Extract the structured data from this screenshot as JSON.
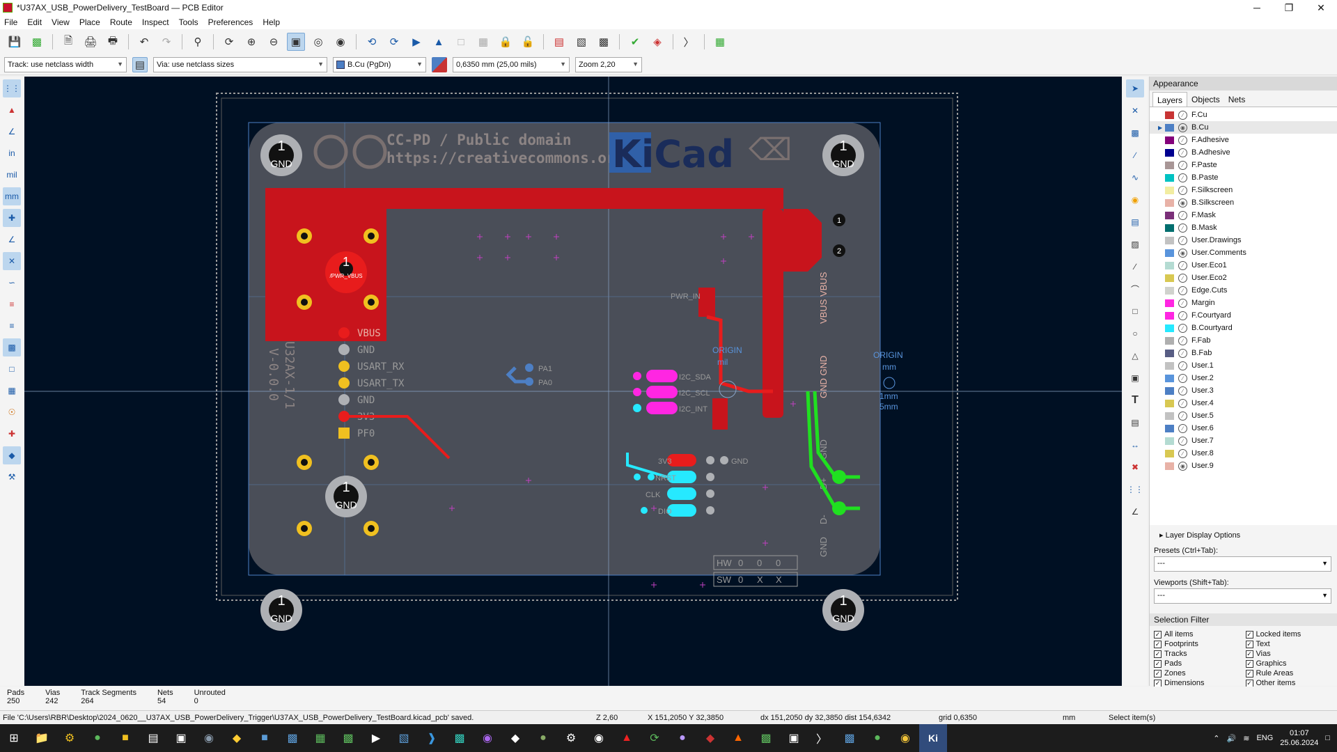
{
  "window": {
    "title": "*U37AX_USB_PowerDelivery_TestBoard — PCB Editor",
    "controls": [
      "─",
      "❐",
      "✕"
    ]
  },
  "menu": [
    "File",
    "Edit",
    "View",
    "Place",
    "Route",
    "Inspect",
    "Tools",
    "Preferences",
    "Help"
  ],
  "toolbar": {
    "icons": [
      "save-icon",
      "board-setup-icon",
      "page-settings-icon",
      "print-icon",
      "plot-icon",
      "undo-icon",
      "redo-icon",
      "find-icon",
      "refresh-icon",
      "zoom-in-icon",
      "zoom-out-icon",
      "zoom-fit-icon",
      "zoom-objects-icon",
      "zoom-area-icon",
      "rotate-ccw-icon",
      "rotate-cw-icon",
      "flip-icon",
      "mirror-icon",
      "group-icon",
      "ungroup-icon",
      "lock-icon",
      "unlock-icon",
      "netlist-icon",
      "footprint-editor-icon",
      "footprint-browser-icon",
      "drc-icon",
      "zones-icon",
      "python-icon",
      "plugin-icon"
    ]
  },
  "options": {
    "track": "Track: use netclass width",
    "via": "Via: use netclass sizes",
    "layer": "B.Cu (PgDn)",
    "layer_color": "#4d7fc4",
    "grid": "0,6350 mm (25,00 mils)",
    "zoom": "Zoom 2,20"
  },
  "left_tools": [
    "grid-icon",
    "drc-marker-icon",
    "ratsnest-icon",
    "inches-unit",
    "mils-unit",
    "mm-unit",
    "cursor-icon",
    "polar-icon",
    "ratsnest-lines-icon",
    "curved-ratsnest-icon",
    "zone-fill-icon",
    "zone-outline-icon",
    "track-display-icon",
    "via-display-icon",
    "pad-display-icon",
    "high-contrast-icon",
    "net-color-icon",
    "board-layers-icon",
    "properties-icon"
  ],
  "left_labels": {
    "in": "in",
    "mil": "mil",
    "mm": "mm"
  },
  "right_tools": [
    "select-icon",
    "local-ratsnest-icon",
    "footprint-icon",
    "route-track-icon",
    "tune-length-icon",
    "via-icon",
    "zone-icon",
    "rule-area-icon",
    "line-icon",
    "arc-icon",
    "rect-icon",
    "circle-icon",
    "polygon-icon",
    "image-icon",
    "text-icon",
    "textbox-icon",
    "dimension-icon",
    "delete-icon",
    "grid-origin-icon",
    "measure-icon"
  ],
  "board": {
    "silk": [
      "CC-PD / Public domain",
      "https://creativecommons.org"
    ],
    "logo": "KiCad",
    "labels": [
      "VBUS",
      "GND",
      "USART_RX",
      "USART_TX",
      "GND",
      "3V3",
      "PF0",
      "PA1",
      "PA0",
      "I2C_SDA",
      "I2C_SCL",
      "I2C_INT",
      "PWR_IN",
      "3V3",
      "GND",
      "NRST",
      "CLK",
      "DIO",
      "ORIGIN",
      "ORIGIN",
      "mil",
      "mm",
      "1mm",
      "5mm",
      "VBUS VBUS",
      "GND GND",
      "GND",
      "D+",
      "D-",
      "GND",
      "HW",
      "SW",
      "/PWR_VBUS",
      "U32AX-1/1",
      "V-0.0.0"
    ],
    "mount_holes": [
      {
        "n": "1",
        "net": "GND"
      },
      {
        "n": "1",
        "net": "GND"
      },
      {
        "n": "1",
        "net": "GND"
      },
      {
        "n": "1",
        "net": "GND"
      },
      {
        "n": "1",
        "net": "GND"
      }
    ],
    "pwr_pad": {
      "n": "1",
      "net": "/PWR_VBUS"
    },
    "hw_cells": [
      "0",
      "0",
      "0"
    ],
    "sw_cells": [
      "0",
      "X",
      "X"
    ],
    "vbus_pads": [
      "1",
      "2"
    ]
  },
  "appearance": {
    "title": "Appearance",
    "tabs": [
      "Layers",
      "Objects",
      "Nets"
    ],
    "layers": [
      {
        "name": "F.Cu",
        "color": "#c83434",
        "vis": false
      },
      {
        "name": "B.Cu",
        "color": "#4d7fc4",
        "vis": true,
        "active": true
      },
      {
        "name": "F.Adhesive",
        "color": "#84007a",
        "vis": false
      },
      {
        "name": "B.Adhesive",
        "color": "#00008f",
        "vis": false
      },
      {
        "name": "F.Paste",
        "color": "#a89696",
        "vis": false
      },
      {
        "name": "B.Paste",
        "color": "#00c2c2",
        "vis": false
      },
      {
        "name": "F.Silkscreen",
        "color": "#f2eda1",
        "vis": false
      },
      {
        "name": "B.Silkscreen",
        "color": "#e8b2a7",
        "vis": true
      },
      {
        "name": "F.Mask",
        "color": "#7a2f78",
        "vis": false
      },
      {
        "name": "B.Mask",
        "color": "#016e6e",
        "vis": false
      },
      {
        "name": "User.Drawings",
        "color": "#c2c2c2",
        "vis": false
      },
      {
        "name": "User.Comments",
        "color": "#5994dc",
        "vis": true
      },
      {
        "name": "User.Eco1",
        "color": "#b4dbd2",
        "vis": false
      },
      {
        "name": "User.Eco2",
        "color": "#d8c852",
        "vis": false
      },
      {
        "name": "Edge.Cuts",
        "color": "#d0d2cd",
        "vis": false
      },
      {
        "name": "Margin",
        "color": "#ff26e2",
        "vis": false
      },
      {
        "name": "F.Courtyard",
        "color": "#ff26e2",
        "vis": false
      },
      {
        "name": "B.Courtyard",
        "color": "#26e9ff",
        "vis": false
      },
      {
        "name": "F.Fab",
        "color": "#afafaf",
        "vis": false
      },
      {
        "name": "B.Fab",
        "color": "#585d84",
        "vis": false
      },
      {
        "name": "User.1",
        "color": "#c2c2c2",
        "vis": false
      },
      {
        "name": "User.2",
        "color": "#5994dc",
        "vis": false
      },
      {
        "name": "User.3",
        "color": "#4d7fc4",
        "vis": false
      },
      {
        "name": "User.4",
        "color": "#d8c852",
        "vis": false
      },
      {
        "name": "User.5",
        "color": "#c2c2c2",
        "vis": false
      },
      {
        "name": "User.6",
        "color": "#4d7fc4",
        "vis": false
      },
      {
        "name": "User.7",
        "color": "#b4dbd2",
        "vis": false
      },
      {
        "name": "User.8",
        "color": "#d8c852",
        "vis": false
      },
      {
        "name": "User.9",
        "color": "#e8b2a7",
        "vis": true
      }
    ],
    "layer_display_options": "Layer Display Options",
    "presets_label": "Presets (Ctrl+Tab):",
    "presets_value": "---",
    "viewports_label": "Viewports (Shift+Tab):",
    "viewports_value": "---"
  },
  "selection_filter": {
    "title": "Selection Filter",
    "items": [
      "All items",
      "Locked items",
      "Footprints",
      "Text",
      "Tracks",
      "Vias",
      "Pads",
      "Graphics",
      "Zones",
      "Rule Areas",
      "Dimensions",
      "Other items"
    ]
  },
  "stats": [
    {
      "label": "Pads",
      "value": "250"
    },
    {
      "label": "Vias",
      "value": "242"
    },
    {
      "label": "Track Segments",
      "value": "264"
    },
    {
      "label": "Nets",
      "value": "54"
    },
    {
      "label": "Unrouted",
      "value": "0"
    }
  ],
  "status": {
    "message": "File 'C:\\Users\\RBR\\Desktop\\2024_0620__U37AX_USB_PowerDelivery_Trigger\\U37AX_USB_PowerDelivery_TestBoard.kicad_pcb' saved.",
    "z": "Z 2,60",
    "xy": "X 151,2050  Y 32,3850",
    "delta": "dx 151,2050  dy 32,3850  dist 154,6342",
    "grid": "grid 0,6350",
    "units": "mm",
    "mode": "Select item(s)"
  },
  "taskbar": {
    "apps": [
      "start-icon",
      "explorer-icon",
      "app-icon",
      "app-icon",
      "app-icon",
      "calendar-icon",
      "app-icon",
      "app-icon",
      "app-icon",
      "app-icon",
      "app-icon",
      "app-icon",
      "app-icon",
      "app-icon",
      "vscode-icon",
      "app-icon",
      "app-icon",
      "app-icon",
      "app-icon",
      "app-icon",
      "app-icon",
      "app-icon",
      "app-icon",
      "app-icon",
      "app-icon",
      "acrobat-icon",
      "sync-icon",
      "github-icon",
      "app-icon",
      "brave-icon",
      "app-icon",
      "app-icon",
      "terminal-icon",
      "app-icon",
      "app-icon",
      "chrome-icon",
      "kicad-icon"
    ],
    "lang": "ENG",
    "time": "01:07",
    "date": "25.06.2024"
  }
}
